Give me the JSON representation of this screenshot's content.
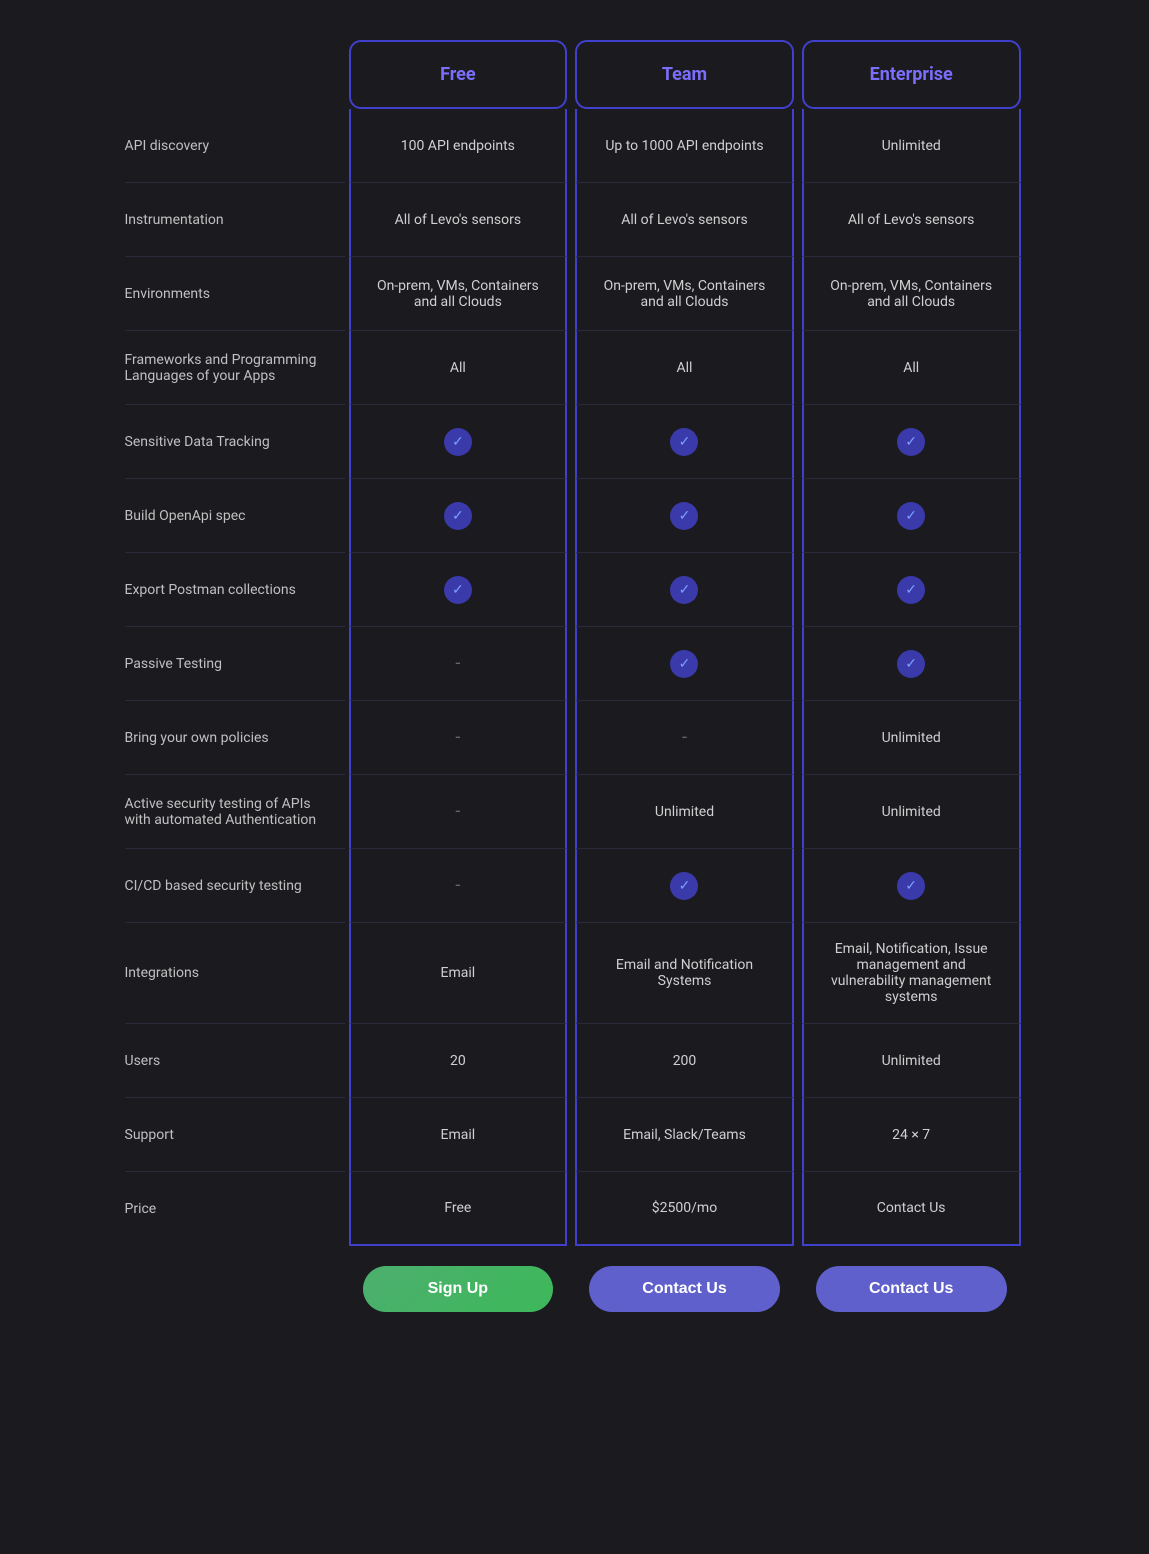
{
  "plans": {
    "free": {
      "label": "Free",
      "color": "#7c6efc"
    },
    "team": {
      "label": "Team",
      "color": "#7c6efc"
    },
    "enterprise": {
      "label": "Enterprise",
      "color": "#7c6efc"
    }
  },
  "features": [
    {
      "name": "API discovery",
      "free": "100 API endpoints",
      "team": "Up to 1000 API endpoints",
      "enterprise": "Unlimited"
    },
    {
      "name": "Instrumentation",
      "free": "All of Levo's sensors",
      "team": "All of Levo's sensors",
      "enterprise": "All of Levo's sensors"
    },
    {
      "name": "Environments",
      "free": "On-prem, VMs, Containers and all Clouds",
      "team": "On-prem, VMs, Containers and all Clouds",
      "enterprise": "On-prem, VMs, Containers and all Clouds"
    },
    {
      "name": "Frameworks and Programming Languages of your Apps",
      "free": "All",
      "team": "All",
      "enterprise": "All"
    },
    {
      "name": "Sensitive Data Tracking",
      "free": "check",
      "team": "check",
      "enterprise": "check"
    },
    {
      "name": "Build OpenApi spec",
      "free": "check",
      "team": "check",
      "enterprise": "check"
    },
    {
      "name": "Export Postman collections",
      "free": "check",
      "team": "check",
      "enterprise": "check"
    },
    {
      "name": "Passive Testing",
      "free": "-",
      "team": "check",
      "enterprise": "check"
    },
    {
      "name": "Bring your own policies",
      "free": "-",
      "team": "-",
      "enterprise": "Unlimited"
    },
    {
      "name": "Active security testing of APIs with automated Authentication",
      "free": "-",
      "team": "Unlimited",
      "enterprise": "Unlimited"
    },
    {
      "name": "CI/CD based security testing",
      "free": "-",
      "team": "check",
      "enterprise": "check"
    },
    {
      "name": "Integrations",
      "free": "Email",
      "team": "Email and Notification Systems",
      "enterprise": "Email, Notification, Issue management and vulnerability management systems"
    },
    {
      "name": "Users",
      "free": "20",
      "team": "200",
      "enterprise": "Unlimited"
    },
    {
      "name": "Support",
      "free": "Email",
      "team": "Email, Slack/Teams",
      "enterprise": "24 × 7"
    },
    {
      "name": "Price",
      "free": "Free",
      "team": "$2500/mo",
      "enterprise": "Contact Us"
    }
  ],
  "buttons": {
    "free_cta": "Sign Up",
    "team_cta": "Contact Us",
    "enterprise_cta": "Contact Us"
  }
}
